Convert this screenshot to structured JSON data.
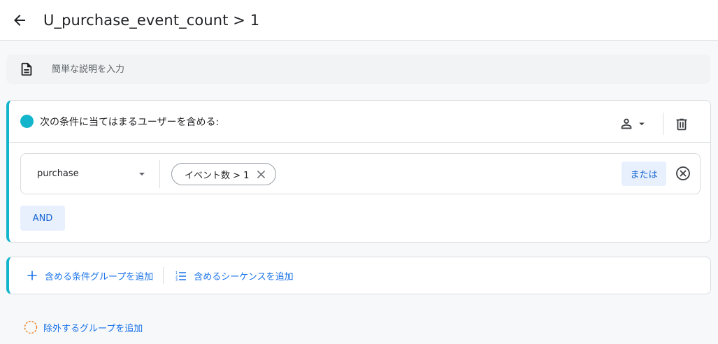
{
  "header": {
    "title": "U_purchase_event_count > 1",
    "back_icon": "arrow-back-icon"
  },
  "description": {
    "placeholder": "簡単な説明を入力",
    "value": "",
    "icon": "document-icon"
  },
  "include_group": {
    "title": "次の条件に当てはまるユーザーを含める:",
    "accent_color": "#12b5cb",
    "scope_icon": "person-icon",
    "delete_icon": "trash-icon",
    "condition": {
      "event_name": "purchase",
      "filter_chip": "イベント数 > 1",
      "or_label": "または"
    },
    "and_label": "AND"
  },
  "add_actions": {
    "add_condition_group": "含める条件グループを追加",
    "add_sequence": "含めるシーケンスを追加"
  },
  "exclude": {
    "label": "除外するグループを追加",
    "icon_color": "#e8710a"
  }
}
